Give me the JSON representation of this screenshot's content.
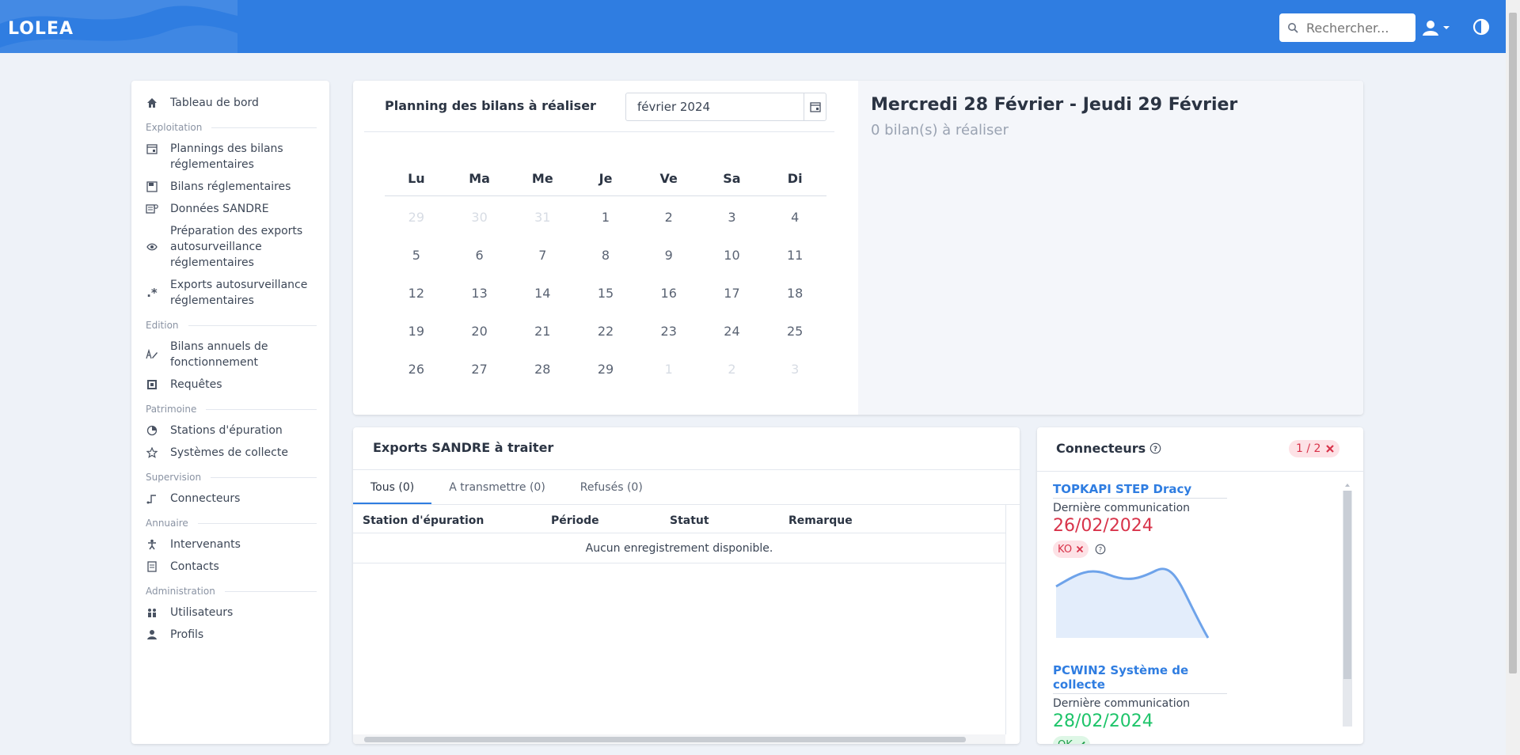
{
  "header": {
    "logo": "LOLEA",
    "search_placeholder": "Rechercher...",
    "accent": "#2f7de1"
  },
  "sidebar": {
    "dashboard": "Tableau de bord",
    "sections": {
      "exploitation": "Exploitation",
      "edition": "Edition",
      "patrimoine": "Patrimoine",
      "supervision": "Supervision",
      "annuaire": "Annuaire",
      "administration": "Administration"
    },
    "items": {
      "plannings": "Plannings des bilans réglementaires",
      "bilans": "Bilans réglementaires",
      "sandre": "Données SANDRE",
      "preparation": "Préparation des exports autosurveillance réglementaires",
      "exports": "Exports autosurveillance réglementaires",
      "bilans_annuels": "Bilans annuels de fonctionnement",
      "requetes": "Requêtes",
      "stations": "Stations d'épuration",
      "systemes": "Systèmes de collecte",
      "connecteurs": "Connecteurs",
      "intervenants": "Intervenants",
      "contacts": "Contacts",
      "utilisateurs": "Utilisateurs",
      "profils": "Profils"
    }
  },
  "planning": {
    "title": "Planning des bilans à réaliser",
    "month": "février 2024",
    "weekdays": [
      "Lu",
      "Ma",
      "Me",
      "Je",
      "Ve",
      "Sa",
      "Di"
    ],
    "weeks": [
      [
        "29",
        "30",
        "31",
        "1",
        "2",
        "3",
        "4"
      ],
      [
        "5",
        "6",
        "7",
        "8",
        "9",
        "10",
        "11"
      ],
      [
        "12",
        "13",
        "14",
        "15",
        "16",
        "17",
        "18"
      ],
      [
        "19",
        "20",
        "21",
        "22",
        "23",
        "24",
        "25"
      ],
      [
        "26",
        "27",
        "28",
        "29",
        "1",
        "2",
        "3"
      ]
    ],
    "selected_range": "Mercredi 28 Février - Jeudi 29 Février",
    "count_text": "0 bilan(s) à réaliser"
  },
  "exports": {
    "title": "Exports SANDRE à traiter",
    "tabs": [
      "Tous (0)",
      "A transmettre (0)",
      "Refusés (0)"
    ],
    "columns": [
      "Station d'épuration",
      "Période",
      "Statut",
      "Remarque"
    ],
    "empty": "Aucun enregistrement disponible."
  },
  "connecteurs": {
    "title": "Connecteurs",
    "count": "1 / 2",
    "last_comm_label": "Dernière communication",
    "items": [
      {
        "name": "TOPKAPI STEP Dracy",
        "date": "26/02/2024",
        "status": "KO",
        "status_color": "#d8334a"
      },
      {
        "name": "PCWIN2 Système de collecte",
        "date": "28/02/2024",
        "status": "OK",
        "status_color": "#1ec46a"
      }
    ]
  }
}
